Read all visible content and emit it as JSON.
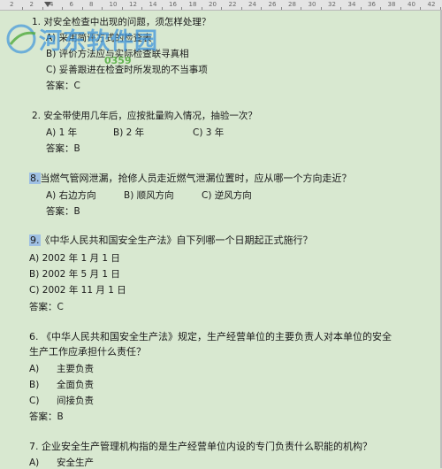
{
  "ruler": {
    "ticks": [
      "2",
      "2",
      "4",
      "6",
      "8",
      "10",
      "12",
      "14",
      "16",
      "18",
      "20",
      "22",
      "24",
      "26",
      "28",
      "30",
      "32",
      "34",
      "36",
      "38",
      "40",
      "42"
    ]
  },
  "watermark": {
    "site_name": "河东软件园",
    "sub_text": "0359"
  },
  "questions": [
    {
      "id": "q1",
      "stem": "1. 对安全检查中出现的问题，须怎样处理？",
      "options": [
        "A) 采用简评方式的检查表",
        "B) 评价方法应与实际检查联寻真相",
        "C) 妥善跟进在检查时所发现的不当事项"
      ],
      "answer": "答案：C"
    },
    {
      "id": "q2",
      "stem": "2. 安全带使用几年后，应按批量购入情况，抽验一次？",
      "options": [
        "A) 1 年",
        "B) 2 年",
        "C) 3 年"
      ],
      "answer": "答案：B"
    },
    {
      "id": "q8",
      "number": "8.",
      "stem": "当燃气管网泄漏，抢修人员走近燃气泄漏位置时，应从哪一个方向走近？",
      "options": [
        "A) 右边方向",
        "B) 顺风方向",
        "C) 逆风方向"
      ],
      "answer": "答案：B"
    },
    {
      "id": "q9",
      "number": "9.",
      "stem": "《中华人民共和国安全生产法》自下列哪一个日期起正式施行？",
      "options": [
        "A)  2002 年 1 月 1 日",
        "B)  2002 年 5 月 1 日",
        "C)  2002 年 11 月 1 日"
      ],
      "answer": "答案：C"
    },
    {
      "id": "q6",
      "stem_line1": "6. 《中华人民共和国安全生产法》规定，生产经营单位的主要负责人对本单位的安全",
      "stem_line2": "生产工作应承担什么责任？",
      "options": [
        {
          "letter": "A)",
          "text": "主要负责"
        },
        {
          "letter": "B)",
          "text": "全面负责"
        },
        {
          "letter": "C)",
          "text": "间接负责"
        }
      ],
      "answer": "答案：B"
    },
    {
      "id": "q7",
      "stem": "7. 企业安全生产管理机构指的是生产经营单位内设的专门负责什么职能的机构？",
      "options": [
        {
          "letter": "A)",
          "text": "安全生产"
        }
      ]
    }
  ]
}
